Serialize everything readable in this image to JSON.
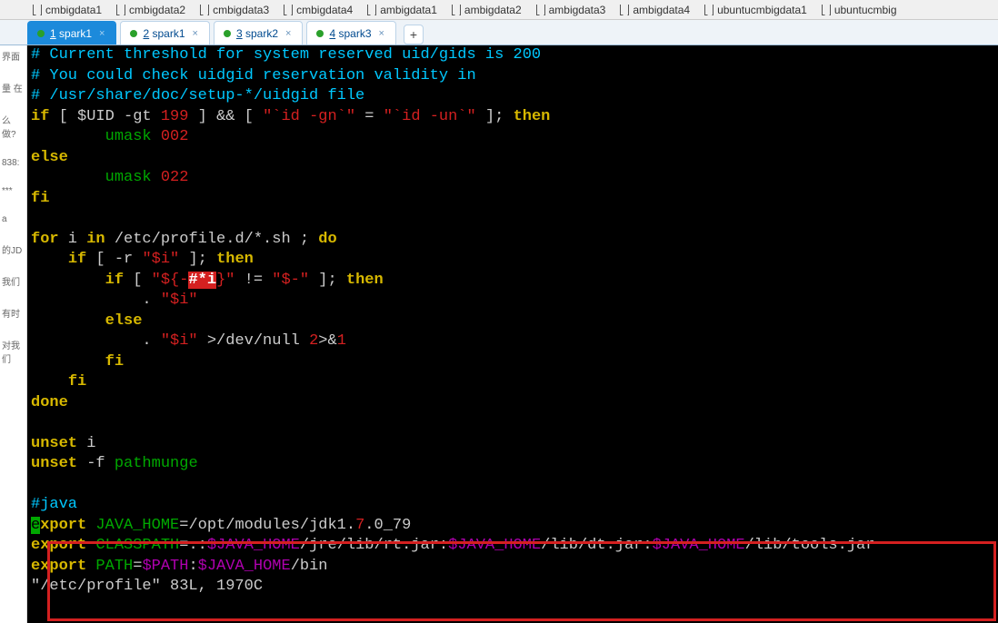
{
  "bookmarks": [
    {
      "label": "cmbigdata1"
    },
    {
      "label": "cmbigdata2"
    },
    {
      "label": "cmbigdata3"
    },
    {
      "label": "cmbigdata4"
    },
    {
      "label": "ambigdata1"
    },
    {
      "label": "ambigdata2"
    },
    {
      "label": "ambigdata3"
    },
    {
      "label": "ambigdata4"
    },
    {
      "label": "ubuntucmbigdata1"
    },
    {
      "label": "ubuntucmbig"
    }
  ],
  "tabs": [
    {
      "num": "1",
      "rest": " spark1",
      "active": true
    },
    {
      "num": "2",
      "rest": " spark1",
      "active": false
    },
    {
      "num": "3",
      "rest": " spark2",
      "active": false
    },
    {
      "num": "4",
      "rest": " spark3",
      "active": false
    }
  ],
  "tab_add_label": "+",
  "tab_close_label": "×",
  "left_gutter_lines": [
    "界面",
    "量 在",
    "",
    "么做?",
    "838:",
    "",
    "***",
    "a",
    "",
    "的JD",
    "我们",
    "",
    "  有时",
    "对我们"
  ],
  "terminal": {
    "l1": "# Current threshold for system reserved uid/gids is 200",
    "l2": "# You could check uidgid reservation validity in",
    "l3": "# /usr/share/doc/setup-*/uidgid file",
    "l4_if": "if",
    "l4_open": " [ ",
    "l4_uid": "$UID",
    "l4_gt": " -gt ",
    "l4_199": "199",
    "l4_close": " ] ",
    "l4_and": "&&",
    "l4_open2": " [ ",
    "l4_q1": "\"`id -gn`\"",
    "l4_eq": " = ",
    "l4_q2": "\"`id -un`\"",
    "l4_close2": " ]; ",
    "l4_then": "then",
    "l5_pad": "        ",
    "l5_umask": "umask",
    "l5_002": " 002",
    "l6_else": "else",
    "l7_pad": "        ",
    "l7_umask": "umask",
    "l7_022": " 022",
    "l8_fi": "fi",
    "l10_for": "for",
    "l10_i": " i ",
    "l10_in": "in",
    "l10_path": " /etc/profile.d/*.sh ; ",
    "l10_do": "do",
    "l11_pad": "    ",
    "l11_if": "if",
    "l11_b": " [ -r ",
    "l11_s": "\"$i\"",
    "l11_c": " ]; ",
    "l11_then": "then",
    "l12_pad": "        ",
    "l12_if": "if",
    "l12_b": " [ ",
    "l12_s1": "\"${-",
    "l12_search": "#*i",
    "l12_s2": "}\"",
    "l12_ne": " != ",
    "l12_s3": "\"$-\"",
    "l12_c": " ]; ",
    "l12_then": "then",
    "l13_pad": "            . ",
    "l13_s": "\"$i\"",
    "l14_pad": "        ",
    "l14_else": "else",
    "l15_pad": "            . ",
    "l15_s": "\"$i\"",
    "l15_gt": " >",
    "l15_dn": "/dev/null ",
    "l15_2": "2",
    "l15_amp": ">&",
    "l15_1": "1",
    "l16_pad": "        ",
    "l16_fi": "fi",
    "l17_pad": "    ",
    "l17_fi": "fi",
    "l18_done": "done",
    "l20_unset": "unset",
    "l20_i": " i",
    "l21_unset": "unset",
    "l21_f": " -f ",
    "l21_pm": "pathmunge",
    "l23_java": "#java",
    "l24_cursor": "e",
    "l24_export": "xport",
    "l24_jh": " JAVA_HOME",
    "l24_eq": "=",
    "l24_path1": "/opt/modules/jdk1",
    "l24_dot1": ".",
    "l24_7": "7",
    "l24_dot2": ".",
    "l24_rest": "0_79",
    "l25_export": "export",
    "l25_cp": " CLASSPATH",
    "l25_eq": "=.:",
    "l25_v1": "$JAVA_HOME",
    "l25_p1": "/jre/lib/rt.jar",
    "l25_c1": ":",
    "l25_v2": "$JAVA_HOME",
    "l25_p2": "/lib/dt.jar",
    "l25_c2": ":",
    "l25_v3": "$JAVA_HOME",
    "l25_p3": "/lib/tools.jar",
    "l26_export": "export",
    "l26_path": " PATH",
    "l26_eq": "=",
    "l26_v1": "$PATH",
    "l26_c1": ":",
    "l26_v2": "$JAVA_HOME",
    "l26_p1": "/bin",
    "l27_status": "\"/etc/profile\" 83L, 1970C"
  }
}
